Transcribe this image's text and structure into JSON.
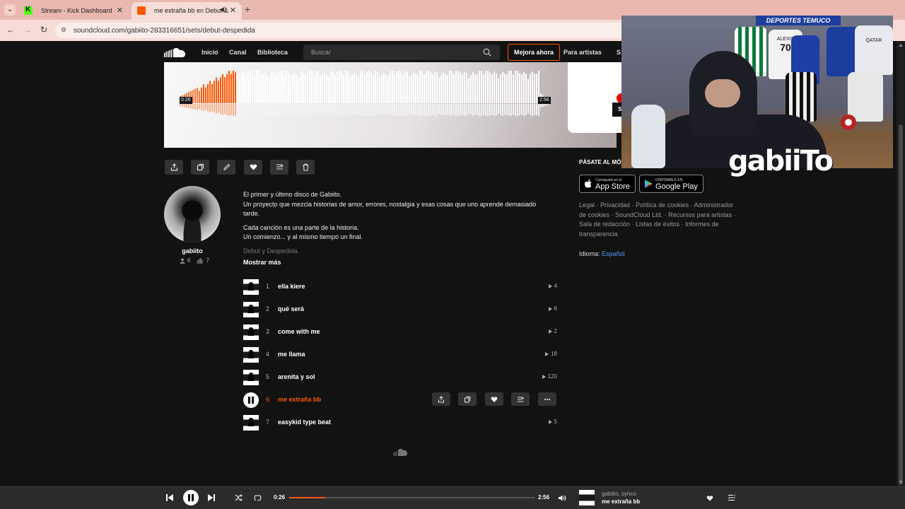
{
  "browser": {
    "tabs": [
      {
        "label": "Stream - Kick Dashboard"
      },
      {
        "label": "me extraña bb en Debut &"
      }
    ],
    "url": "soundcloud.com/gabiito-283316651/sets/debut-despedida"
  },
  "header": {
    "nav": [
      "Inicio",
      "Canal",
      "Biblioteca"
    ],
    "search_placeholder": "Buscar",
    "upgrade_label": "Mejora ahora",
    "for_artists_label": "Para artistas",
    "cut_label": "S"
  },
  "hero": {
    "elapsed": "0:26",
    "duration": "2:56",
    "progress_fraction": 0.148,
    "card_button_label": "S"
  },
  "artist": {
    "name": "gabiito",
    "followers": "6",
    "tracks": "7"
  },
  "description": {
    "lines": [
      "El primer y último disco de Gabiito.",
      "Un proyecto que mezcla historias de amor, errores, nostalgia y esas cosas que uno aprende demasiado tarde.",
      "Cada canción es una parte de la historia.",
      "Un comienzo... y al mismo tiempo un final.",
      "Debut y Despedida."
    ],
    "show_more": "Mostrar más"
  },
  "tracks": [
    {
      "num": "1",
      "title": "ella kiere",
      "plays": "4"
    },
    {
      "num": "2",
      "title": "qué será",
      "plays": "6"
    },
    {
      "num": "3",
      "title": "come with me",
      "plays": "2"
    },
    {
      "num": "4",
      "title": "me llama",
      "plays": "18"
    },
    {
      "num": "5",
      "title": "arenita y sol",
      "plays": "120"
    },
    {
      "num": "6",
      "title": "me extraña bb",
      "plays": ""
    },
    {
      "num": "7",
      "title": "easykid type beat",
      "plays": "5"
    }
  ],
  "sidebar": {
    "mobile_title": "PÁSATE AL MÓV",
    "app_store": {
      "small": "Consíguelo en el",
      "big": "App Store"
    },
    "google_play": {
      "small": "DISPONIBLE EN",
      "big": "Google Play"
    },
    "footer_links": "Legal · Privacidad · Política de cookies · Administrador de cookies · SoundCloud Ltd. · Recursos para artistas · Sala de redacción · Listas de éxitos · Informes de transparencia",
    "language_label": "Idioma:",
    "language_value": "Español"
  },
  "webcam": {
    "banner": "DEPORTES TEMUCO",
    "brand": "gabiiTo",
    "jersey_label": "ALEXIS",
    "jersey_number": "70",
    "jersey2_text": "QATAR"
  },
  "player": {
    "elapsed": "0:26",
    "duration": "2:56",
    "progress_fraction": 0.148,
    "artist": "gabiito, synco",
    "title": "me extraña bb"
  },
  "colors": {
    "accent": "#ff5500",
    "background": "#121212",
    "link": "#4f9cff"
  }
}
